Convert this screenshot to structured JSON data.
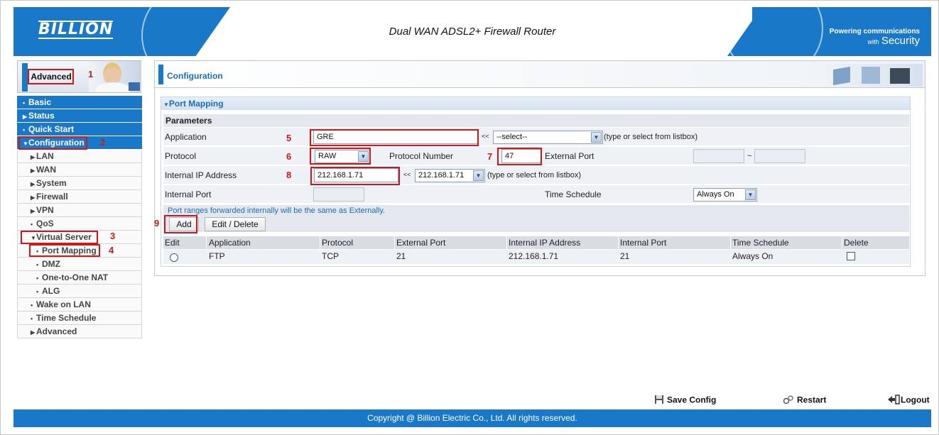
{
  "header": {
    "logo": "BILLION",
    "product_title": "Dual WAN ADSL2+ Firewall Router",
    "tagline_1": "Powering communications",
    "tagline_2": "with",
    "tagline_3": "Security"
  },
  "sidebar": {
    "mode_label": "Advanced",
    "items": [
      {
        "label": "Basic",
        "level": "top"
      },
      {
        "label": "Status",
        "level": "top"
      },
      {
        "label": "Quick Start",
        "level": "top"
      },
      {
        "label": "Configuration",
        "level": "top"
      },
      {
        "label": "LAN",
        "level": "sub"
      },
      {
        "label": "WAN",
        "level": "sub"
      },
      {
        "label": "System",
        "level": "sub"
      },
      {
        "label": "Firewall",
        "level": "sub"
      },
      {
        "label": "VPN",
        "level": "sub"
      },
      {
        "label": "QoS",
        "level": "sub"
      },
      {
        "label": "Virtual Server",
        "level": "sub"
      },
      {
        "label": "Port Mapping",
        "level": "sub2"
      },
      {
        "label": "DMZ",
        "level": "sub2"
      },
      {
        "label": "One-to-One NAT",
        "level": "sub2"
      },
      {
        "label": "ALG",
        "level": "sub2"
      },
      {
        "label": "Wake on LAN",
        "level": "sub"
      },
      {
        "label": "Time Schedule",
        "level": "sub"
      },
      {
        "label": "Advanced",
        "level": "sub"
      }
    ]
  },
  "content": {
    "title": "Configuration",
    "section_title": "Port Mapping",
    "params_title": "Parameters",
    "form": {
      "application_label": "Application",
      "application_value": "GRE",
      "application_select": "--select--",
      "select_hint": "(type or select from listbox)",
      "protocol_label": "Protocol",
      "protocol_value": "RAW",
      "protocol_number_label": "Protocol Number",
      "protocol_number_value": "47",
      "external_port_label": "External Port",
      "external_port_from": "",
      "external_port_to": "",
      "range_sep": "~",
      "internal_ip_label": "Internal IP Address",
      "internal_ip_value": "212.168.1.71",
      "internal_ip_select": "212.168.1.71",
      "arrows": "<<",
      "internal_port_label": "Internal Port",
      "internal_port_value": "",
      "time_schedule_label": "Time Schedule",
      "time_schedule_value": "Always On"
    },
    "note": "Port ranges forwarded internally will be the same as Externally.",
    "add_button": "Add",
    "edit_delete_button": "Edit / Delete",
    "table": {
      "headers": [
        "Edit",
        "Application",
        "Protocol",
        "External Port",
        "Internal IP Address",
        "Internal Port",
        "Time Schedule",
        "Delete"
      ],
      "rows": [
        {
          "application": "FTP",
          "protocol": "TCP",
          "external_port": "21",
          "internal_ip": "212.168.1.71",
          "internal_port": "21",
          "time_schedule": "Always On"
        }
      ]
    }
  },
  "annotations": [
    "1",
    "2",
    "3",
    "4",
    "5",
    "6",
    "7",
    "8",
    "9"
  ],
  "annotation_color": "#d01818",
  "accent_color": "#1a78c8",
  "bottom": {
    "save_config": "Save Config",
    "restart": "Restart",
    "logout": "Logout"
  },
  "footer": {
    "copyright": "Copyright @ Billion Electric Co., Ltd. All rights reserved."
  }
}
